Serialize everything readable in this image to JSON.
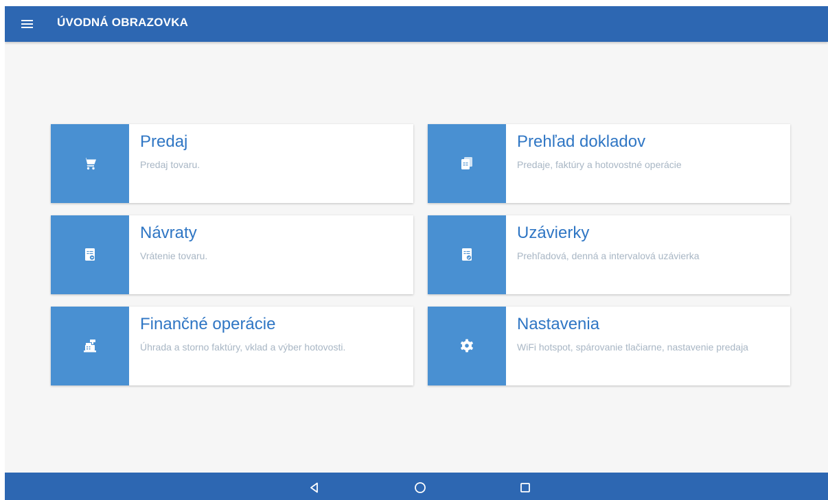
{
  "appbar": {
    "title": "ÚVODNÁ OBRAZOVKA",
    "menu_icon": "hamburger-menu-icon",
    "background": "#2d67b2"
  },
  "tiles": [
    {
      "title": "Predaj",
      "subtitle": "Predaj tovaru.",
      "icon": "shopping-cart-icon"
    },
    {
      "title": "Prehľad dokladov",
      "subtitle": "Predaje, faktúry a hotovostné operácie",
      "icon": "documents-icon"
    },
    {
      "title": "Návraty",
      "subtitle": "Vrátenie tovaru.",
      "icon": "receipt-return-icon"
    },
    {
      "title": "Uzávierky",
      "subtitle": "Prehľadová, denná a intervalová uzávierka",
      "icon": "receipt-check-icon"
    },
    {
      "title": "Finančné operácie",
      "subtitle": "Úhrada a storno faktúry, vklad a výber hotovosti.",
      "icon": "cash-register-icon"
    },
    {
      "title": "Nastavenia",
      "subtitle": "WiFi hotspot, spárovanie tlačiarne, nastavenie predaja",
      "icon": "gear-icon"
    }
  ],
  "colors": {
    "accent": "#4990d2",
    "title_text": "#2f76c4",
    "subtitle_text": "#a8b6c4",
    "background": "#f6f6f6"
  },
  "navbar": {
    "back_icon": "back-triangle-icon",
    "home_icon": "home-circle-icon",
    "recents_icon": "recents-square-icon"
  }
}
